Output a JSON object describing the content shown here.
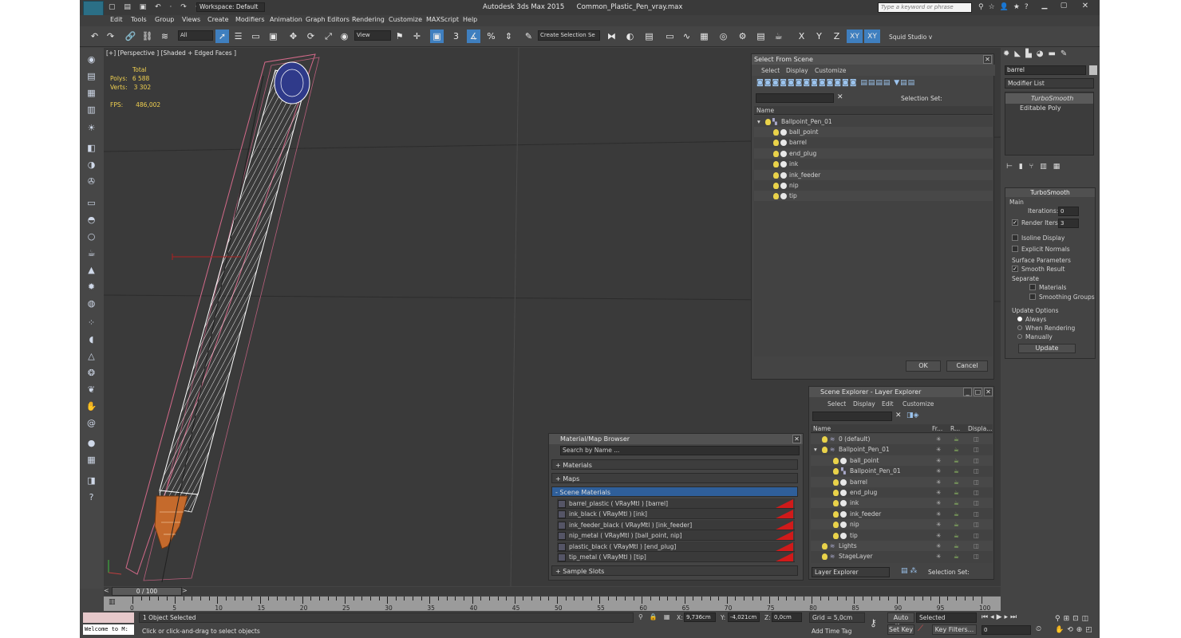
{
  "title": {
    "app": "Autodesk 3ds Max  2015",
    "file": "Common_Plastic_Pen_vray.max",
    "logo": "MAX",
    "workspace": "Workspace: Default",
    "search_placeholder": "Type a keyword or phrase"
  },
  "menu": [
    "Edit",
    "Tools",
    "Group",
    "Views",
    "Create",
    "Modifiers",
    "Animation",
    "Graph Editors",
    "Rendering",
    "Customize",
    "MAXScript",
    "Help"
  ],
  "toolbar": {
    "filter": "All",
    "view": "View",
    "selection_set": "Create Selection Se",
    "snap": "3",
    "axis_x": "X",
    "axis_y": "Y",
    "axis_z": "Z",
    "axis_xy": "XY",
    "axis_xy2": "XY",
    "squid": "Squid Studio v"
  },
  "viewport": {
    "label": "[+] [Perspective ] [Shaded + Edged Faces ]",
    "stats_total": "Total",
    "polys_label": "Polys:",
    "polys_value": "6 588",
    "verts_label": "Verts:",
    "verts_value": "3 302",
    "fps_label": "FPS:",
    "fps_value": "486,002"
  },
  "select_from_scene": {
    "title": "Select From Scene",
    "menu": [
      "Select",
      "Display",
      "Customize"
    ],
    "selection_set_label": "Selection Set:",
    "column_name": "Name",
    "root": "Ballpoint_Pen_01",
    "children": [
      "ball_point",
      "barrel",
      "end_plug",
      "ink",
      "ink_feeder",
      "nip",
      "tip"
    ],
    "ok": "OK",
    "cancel": "Cancel"
  },
  "command_panel": {
    "search_value": "barrel",
    "modifier_list": "Modifier List",
    "stack": [
      "TurboSmooth",
      "Editable Poly"
    ],
    "rollout_title": "TurboSmooth",
    "main_label": "Main",
    "iterations_label": "Iterations:",
    "iterations_value": "0",
    "render_iters_label": "Render Iters:",
    "render_iters_value": "3",
    "isoline": "Isoline Display",
    "explicit": "Explicit Normals",
    "surface_params": "Surface Parameters",
    "smooth_result": "Smooth Result",
    "separate": "Separate",
    "materials": "Materials",
    "smoothing_groups": "Smoothing Groups",
    "update_options": "Update Options",
    "always": "Always",
    "when_rendering": "When Rendering",
    "manually": "Manually",
    "update_button": "Update"
  },
  "material_browser": {
    "title": "Material/Map Browser",
    "search_placeholder": "Search by Name ...",
    "sections": [
      "+ Materials",
      "+ Maps",
      "- Scene Materials"
    ],
    "materials": [
      "barrel_plastic  ( VRayMtl )  [barrel]",
      "ink_black  ( VRayMtl )  [ink]",
      "ink_feeder_black  ( VRayMtl )  [ink_feeder]",
      "nip_metal  ( VRayMtl )  [ball_point, nip]",
      "plastic_black  ( VRayMtl )  [end_plug]",
      "tip_metal  ( VRayMtl )  [tip]"
    ],
    "sample_slots": "+ Sample Slots"
  },
  "scene_explorer": {
    "title": "Scene Explorer - Layer Explorer",
    "menu": [
      "Select",
      "Display",
      "Edit",
      "Customize"
    ],
    "col_name": "Name",
    "col_fr": "Fr...",
    "col_r": "R...",
    "col_disp": "Displa...",
    "rows": [
      {
        "name": "0 (default)",
        "indent": 0,
        "kind": "layer"
      },
      {
        "name": "Ballpoint_Pen_01",
        "indent": 0,
        "kind": "layer"
      },
      {
        "name": "ball_point",
        "indent": 1,
        "kind": "obj"
      },
      {
        "name": "Ballpoint_Pen_01",
        "indent": 1,
        "kind": "group"
      },
      {
        "name": "barrel",
        "indent": 1,
        "kind": "obj"
      },
      {
        "name": "end_plug",
        "indent": 1,
        "kind": "obj"
      },
      {
        "name": "ink",
        "indent": 1,
        "kind": "obj"
      },
      {
        "name": "ink_feeder",
        "indent": 1,
        "kind": "obj"
      },
      {
        "name": "nip",
        "indent": 1,
        "kind": "obj"
      },
      {
        "name": "tip",
        "indent": 1,
        "kind": "obj"
      },
      {
        "name": "Lights",
        "indent": 0,
        "kind": "layer"
      },
      {
        "name": "StageLayer",
        "indent": 0,
        "kind": "layer"
      }
    ],
    "footer_dropdown": "Layer Explorer",
    "footer_selection": "Selection Set:"
  },
  "timeline": {
    "frame": "0 / 100",
    "ticks": [
      "0",
      "5",
      "10",
      "15",
      "20",
      "25",
      "30",
      "35",
      "40",
      "45",
      "50",
      "55",
      "60",
      "65",
      "70",
      "75",
      "80",
      "85",
      "90",
      "95",
      "100"
    ]
  },
  "status": {
    "maxscript": "Welcome to M:",
    "objects_selected": "1 Object Selected",
    "prompt": "Click or click-and-drag to select objects",
    "x_label": "X:",
    "x_value": "9,736cm",
    "y_label": "Y:",
    "y_value": "-4,021cm",
    "z_label": "Z:",
    "z_value": "0,0cm",
    "grid": "Grid = 5,0cm",
    "add_time_tag": "Add Time Tag",
    "auto_key": "Auto Key",
    "set_key": "Set Key",
    "selected": "Selected",
    "key_filters": "Key Filters...",
    "frame_value": "0"
  }
}
